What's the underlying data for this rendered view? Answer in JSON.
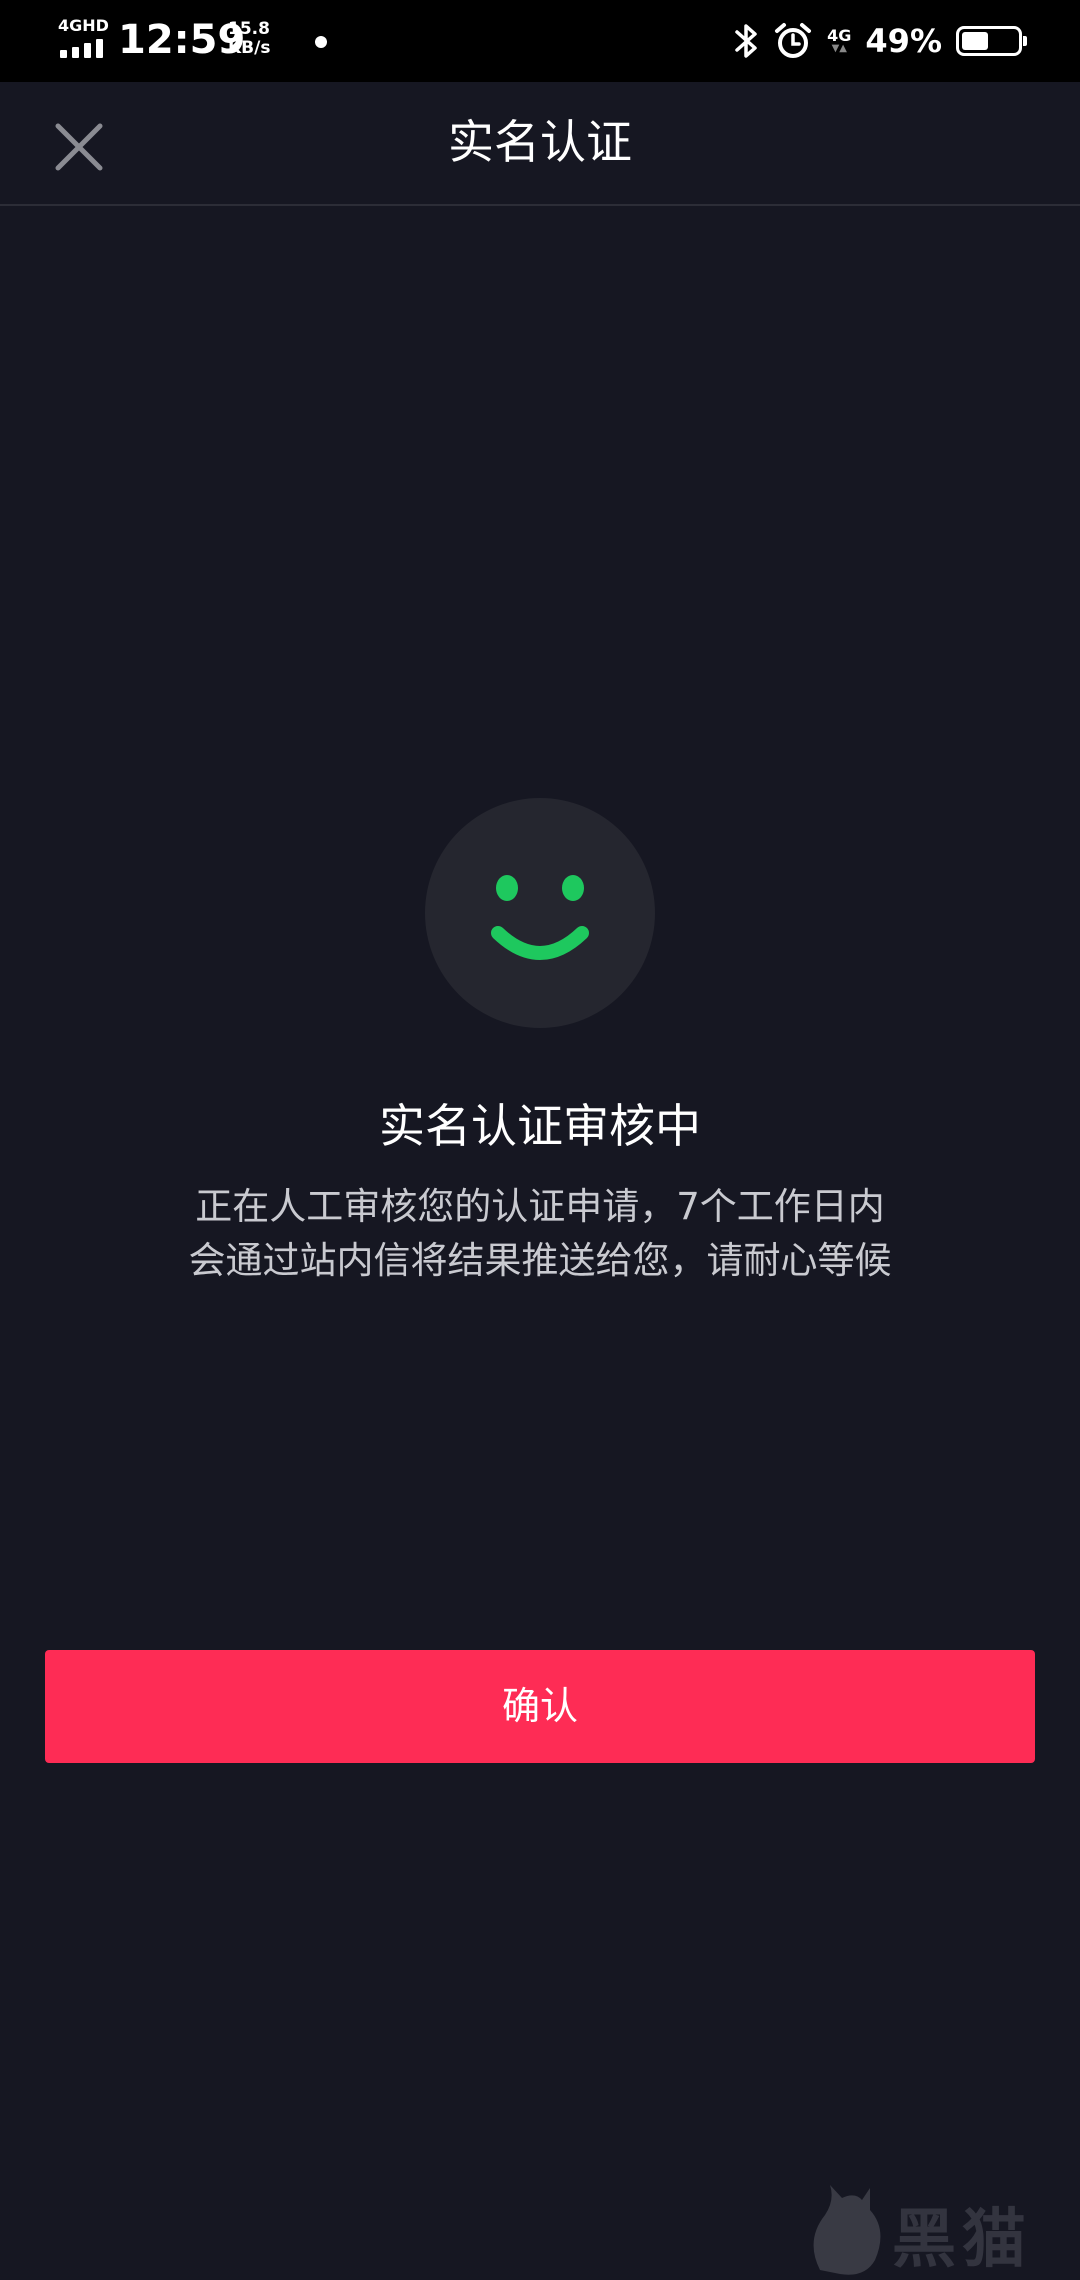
{
  "status_bar": {
    "network_label": "4GHD",
    "time": "12:59",
    "speed_value": "15.8",
    "speed_unit": "KB/s",
    "mobile_data_label": "4G",
    "battery_percent": "49%",
    "battery_level": 0.49
  },
  "nav": {
    "title": "实名认证",
    "close_icon": "close-icon"
  },
  "status": {
    "icon": "smiley-face-icon",
    "accent_color": "#1ec85e",
    "heading": "实名认证审核中",
    "description_lines": [
      "正在人工审核您的认证申请，7个工作日内",
      "会通过站内信将结果推送给您，请耐心等候"
    ]
  },
  "actions": {
    "confirm_label": "确认",
    "confirm_color": "#fe2c55"
  },
  "watermark": {
    "text": "黑猫"
  }
}
